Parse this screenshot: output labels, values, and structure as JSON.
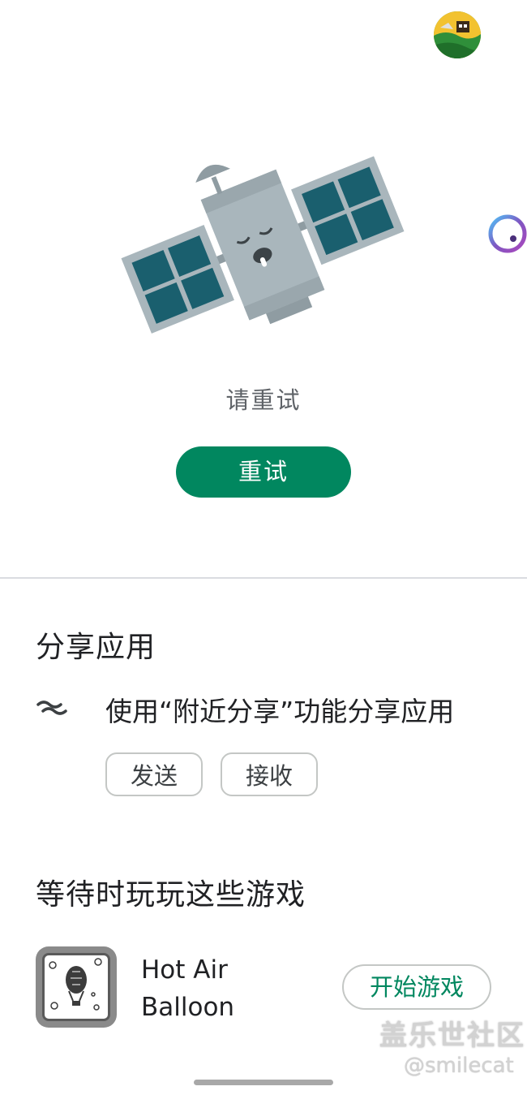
{
  "error": {
    "message": "请重试",
    "retry_label": "重试"
  },
  "share": {
    "title": "分享应用",
    "nearby_text": "使用“附近分享”功能分享应用",
    "send_label": "发送",
    "receive_label": "接收"
  },
  "games": {
    "title": "等待时玩玩这些游戏",
    "items": [
      {
        "name": "Hot Air Balloon",
        "play_label": "开始游戏"
      }
    ]
  },
  "watermark": {
    "line1": "盖乐世社区",
    "line2": "@smilecat"
  },
  "colors": {
    "accent": "#01875f",
    "panel": "#1a5f6e",
    "satellite_body": "#a9b6bc"
  },
  "icons": {
    "avatar": "profile-avatar",
    "nearby_share": "nearby-share-icon",
    "assistant": "assistant-bubble-icon"
  }
}
